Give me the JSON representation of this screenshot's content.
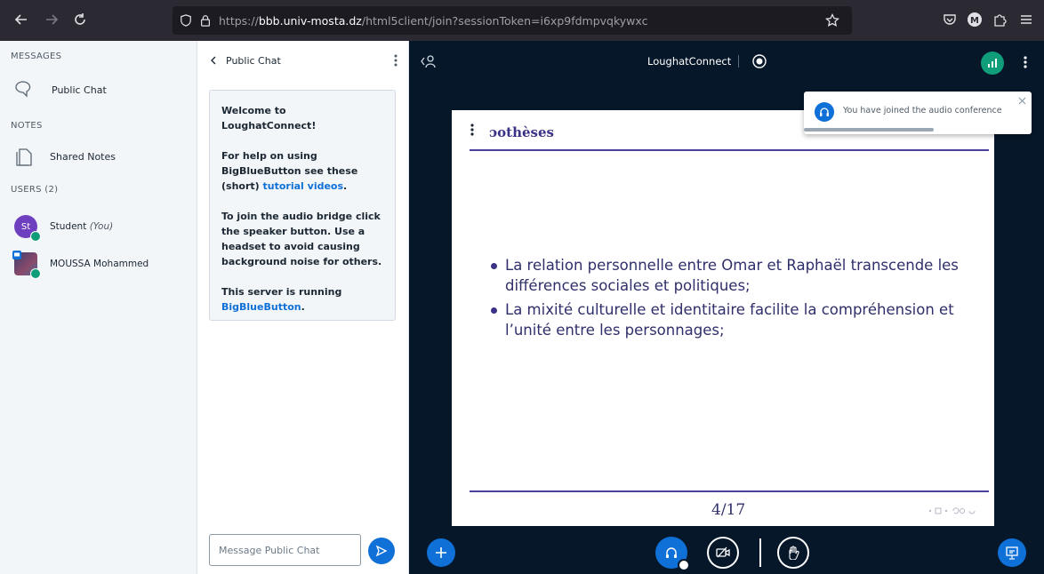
{
  "browser": {
    "url_prefix": "https://",
    "url_host": "bbb.univ-mosta.dz",
    "url_rest": "/html5client/join?sessionToken=i6xp9fdmpvqkywxc"
  },
  "left_nav": {
    "messages_title": "MESSAGES",
    "public_chat_label": "Public Chat",
    "notes_title": "NOTES",
    "shared_notes_label": "Shared Notes",
    "users_title": "USERS (2)",
    "users": [
      {
        "initials": "St",
        "name": "Student",
        "suffix": "(You)",
        "avatar_color": "#6e3fbf"
      },
      {
        "name": "MOUSSA Mohammed"
      }
    ]
  },
  "chat": {
    "title": "Public Chat",
    "welcome_title": "Welcome to LoughatConnect!",
    "help_text": "For help on using BigBlueButton see these (short)",
    "tutorial_link": "tutorial videos",
    "help_end": ".",
    "audio_text": "To join the audio bridge click the speaker button. Use a headset to avoid causing background noise for others.",
    "server_text": "This server is running",
    "bbb_link": "BigBlueButton",
    "server_end": ".",
    "input_placeholder": "Message Public Chat"
  },
  "main": {
    "meeting_title": "LoughatConnect",
    "toast_text": "You have joined the audio conference",
    "slide": {
      "title": "ɔothèses",
      "bullets": [
        "La relation personnelle entre Omar et Raphaël transcende les différences sociales et politiques;",
        "La mixité culturelle et identitaire facilite la compréhension et l’unité entre les personnages;"
      ],
      "page": "4/17"
    }
  },
  "colors": {
    "primary": "#0f70d7",
    "dark_bg": "#06172a",
    "connection_green": "#0f9d7a",
    "slide_accent": "#4a3f98"
  }
}
